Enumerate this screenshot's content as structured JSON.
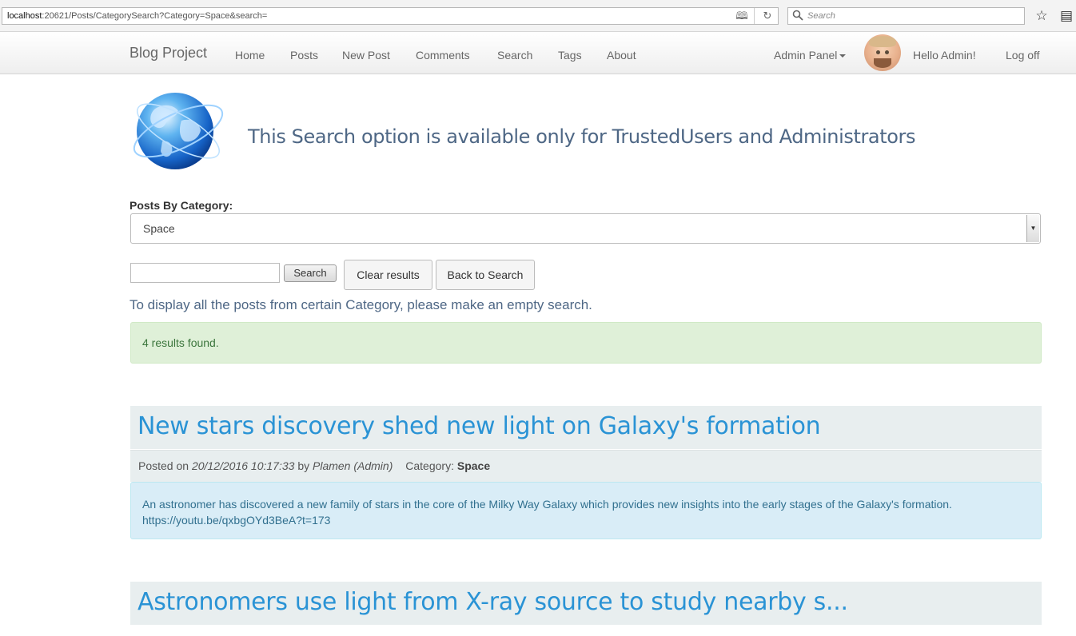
{
  "browser": {
    "url_host": "localhost",
    "url_rest": ":20621/Posts/CategorySearch?Category=Space&search=",
    "search_placeholder": "Search"
  },
  "navbar": {
    "brand": "Blog Project",
    "items": [
      "Home",
      "Posts",
      "New Post",
      "Comments",
      "Search",
      "Tags",
      "About"
    ],
    "admin_panel": "Admin Panel",
    "greeting": "Hello Admin!",
    "logoff": "Log off"
  },
  "header": {
    "title": "This Search option is available only for TrustedUsers and Administrators"
  },
  "category": {
    "label": "Posts By Category:",
    "selected": "Space"
  },
  "search_form": {
    "input_value": "",
    "search_label": "Search",
    "clear_label": "Clear results",
    "back_label": "Back to Search"
  },
  "hint": "To display all the posts from certain Category, please make an empty search.",
  "results": {
    "message": "4 results found."
  },
  "posts": [
    {
      "title": "New stars discovery shed new light on Galaxy's formation",
      "posted_on_label": "Posted on",
      "date": "20/12/2016 10:17:33",
      "by_label": "by",
      "author": "Plamen (Admin)",
      "category_label": "Category:",
      "category": "Space",
      "body": "An astronomer has discovered a new family of stars in the core of the Milky Way Galaxy which provides new insights into the early stages of the Galaxy's formation.",
      "link": "https://youtu.be/qxbgOYd3BeA?t=173"
    },
    {
      "title": "Astronomers use light from X-ray source to study nearby s..."
    }
  ],
  "colors": {
    "heading": "#4e6785",
    "post_title": "#2a93d5",
    "success_bg": "#dff0d8",
    "info_bg": "#d9edf7"
  }
}
